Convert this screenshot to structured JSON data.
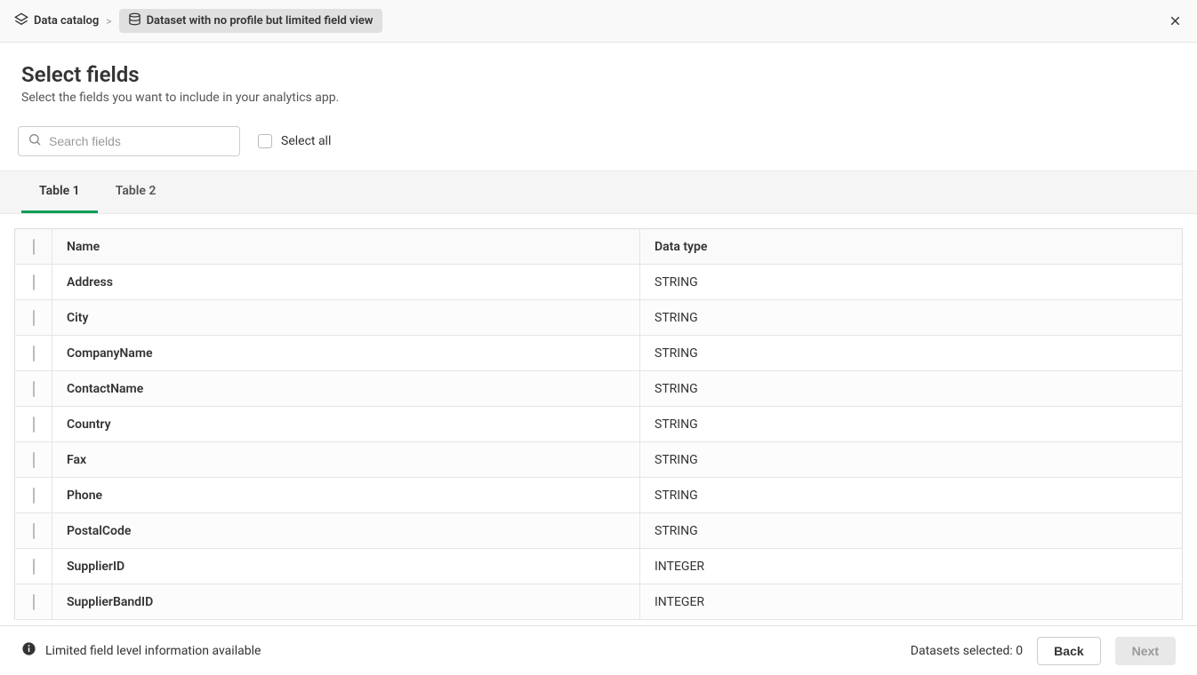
{
  "breadcrumb": {
    "root": "Data catalog",
    "current": "Dataset with no profile but limited field view"
  },
  "header": {
    "title": "Select fields",
    "subtitle": "Select the fields you want to include in your analytics app."
  },
  "search": {
    "placeholder": "Search fields"
  },
  "select_all_label": "Select all",
  "tabs": [
    "Table 1",
    "Table 2"
  ],
  "active_tab_index": 0,
  "table": {
    "headers": {
      "name": "Name",
      "type": "Data type"
    },
    "rows": [
      {
        "name": "Address",
        "type": "STRING"
      },
      {
        "name": "City",
        "type": "STRING"
      },
      {
        "name": "CompanyName",
        "type": "STRING"
      },
      {
        "name": "ContactName",
        "type": "STRING"
      },
      {
        "name": "Country",
        "type": "STRING"
      },
      {
        "name": "Fax",
        "type": "STRING"
      },
      {
        "name": "Phone",
        "type": "STRING"
      },
      {
        "name": "PostalCode",
        "type": "STRING"
      },
      {
        "name": "SupplierID",
        "type": "INTEGER"
      },
      {
        "name": "SupplierBandID",
        "type": "INTEGER"
      }
    ]
  },
  "footer": {
    "info": "Limited field level information available",
    "selected_label": "Datasets selected: 0",
    "back": "Back",
    "next": "Next"
  }
}
